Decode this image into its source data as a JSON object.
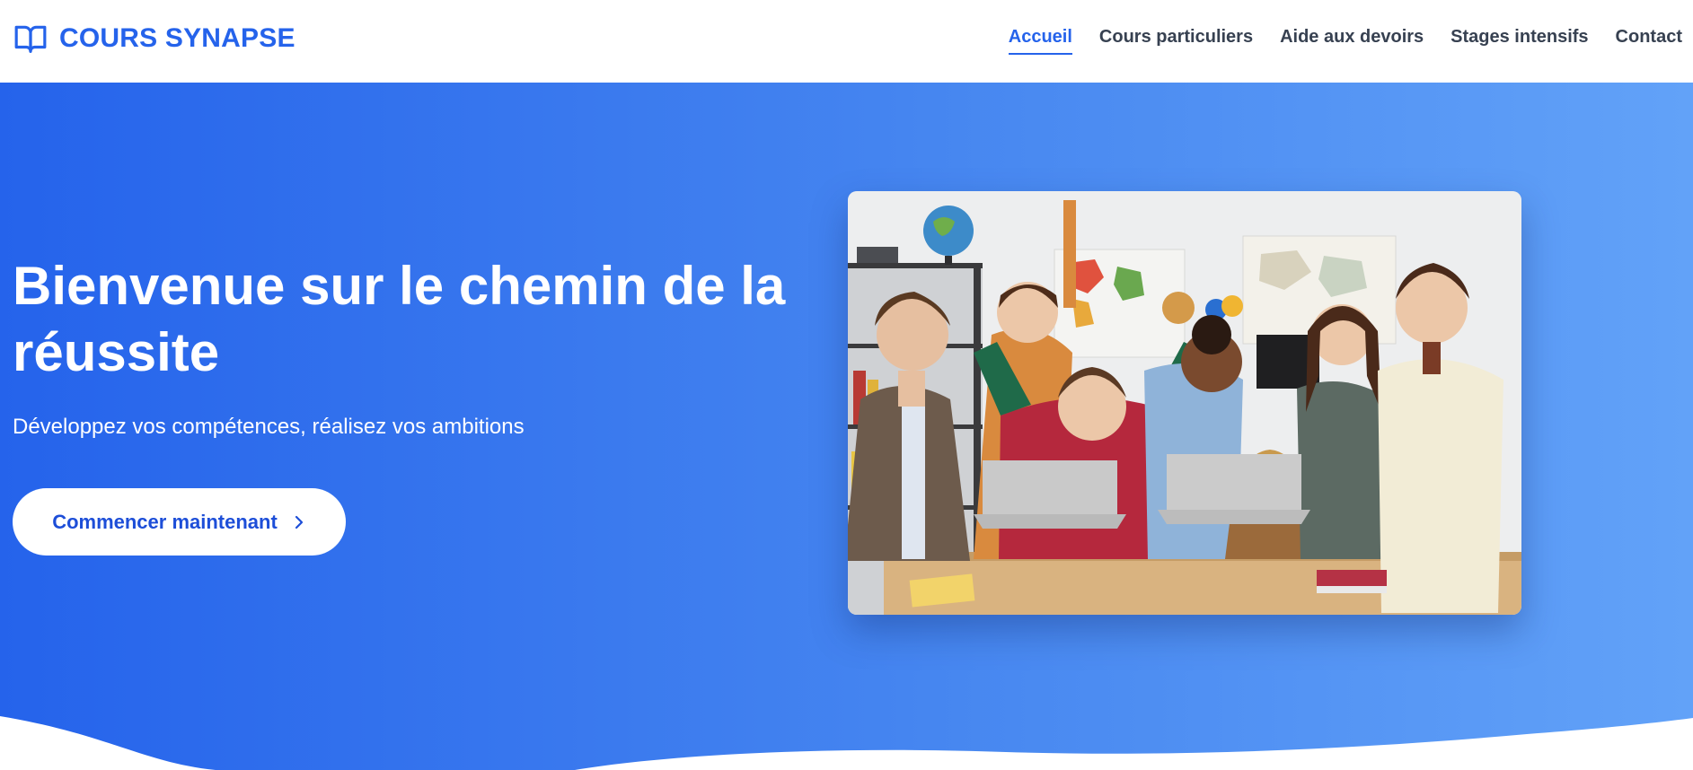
{
  "brand": {
    "name": "COURS SYNAPSE",
    "icon": "open-book-icon",
    "color": "#2563eb"
  },
  "nav": {
    "items": [
      {
        "label": "Accueil",
        "active": true
      },
      {
        "label": "Cours particuliers",
        "active": false
      },
      {
        "label": "Aide aux devoirs",
        "active": false
      },
      {
        "label": "Stages intensifs",
        "active": false
      },
      {
        "label": "Contact",
        "active": false
      }
    ]
  },
  "hero": {
    "title": "Bienvenue sur le chemin de la réussite",
    "subtitle": "Développez vos compétences, réalisez vos ambitions",
    "cta_label": "Commencer maintenant",
    "cta_icon": "chevron-right-icon",
    "gradient_start": "#2563eb",
    "gradient_end": "#62a2f8"
  }
}
